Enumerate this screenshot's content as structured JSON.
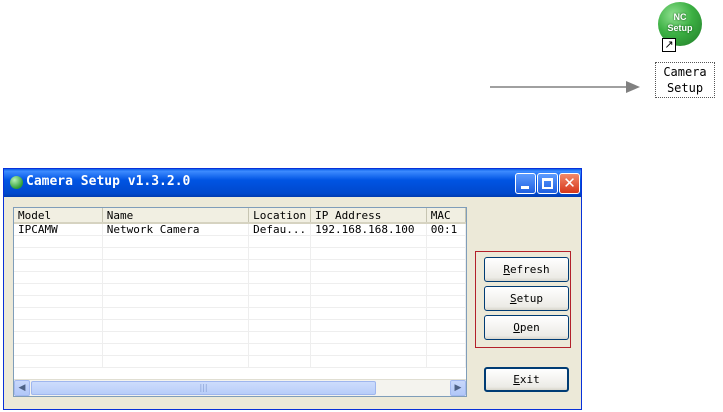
{
  "desktop": {
    "shortcut_icon_text": "NC\nSetup",
    "shortcut_label_line1": "Camera",
    "shortcut_label_line2": "Setup"
  },
  "window": {
    "title": "Camera Setup v1.3.2.0"
  },
  "list": {
    "columns": [
      "Model",
      "Name",
      "Location",
      "IP Address",
      "MAC"
    ],
    "rows": [
      [
        "IPCAMW",
        "Network Camera",
        "Defau...",
        "192.168.168.100",
        "00:1"
      ]
    ]
  },
  "buttons": {
    "refresh_first": "R",
    "refresh_rest": "efresh",
    "setup_first": "S",
    "setup_rest": "etup",
    "open_first": "O",
    "open_rest": "pen",
    "exit_first": "E",
    "exit_rest": "xit"
  },
  "colors": {
    "titlebar": "#0054e3",
    "highlight_box": "#b3202a",
    "window_bg": "#ece9d8"
  }
}
